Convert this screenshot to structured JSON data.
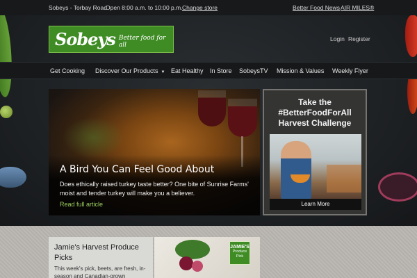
{
  "topbar": {
    "store_name": "Sobeys - Torbay Road",
    "store_hours": "Open 8:00 a.m. to 10:00 p.m.",
    "change_store": "Change store",
    "better_food_news": "Better Food News",
    "air_miles": "AIR MILES®"
  },
  "header": {
    "logo_word": "Sobeys",
    "logo_tagline": "Better food for all",
    "login": "Login",
    "register": "Register"
  },
  "nav": {
    "items": [
      "Get Cooking",
      "Discover Our Products",
      "Eat Healthy",
      "In Store",
      "SobeysTV",
      "Mission & Values",
      "Weekly Flyer"
    ],
    "dropdown_caret": "▼"
  },
  "hero": {
    "title": "A Bird You Can Feel Good About",
    "body": "Does ethically raised turkey taste better? One bite of Sunrise Farms' moist and tender turkey will make you a believer.",
    "link": "Read full article"
  },
  "promo": {
    "title_line1": "Take the",
    "title_line2": "#BetterFoodForAll",
    "title_line3": "Harvest Challenge",
    "button": "Learn More"
  },
  "feature": {
    "title": "Jamie's Harvest Produce Picks",
    "body": "This week's pick, beets, are fresh, in-season and Canadian-grown",
    "badge_line1": "JAMIE'S",
    "badge_line2": "Produce",
    "badge_line3": "Pick"
  }
}
